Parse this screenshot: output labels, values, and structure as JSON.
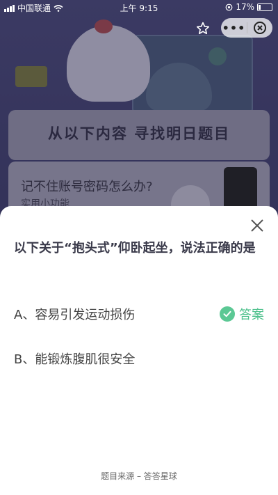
{
  "status_bar": {
    "carrier": "中国联通",
    "time": "上午 9:15",
    "battery": "17%",
    "battery_level": 0.17
  },
  "capsule": {
    "more_label": "•••"
  },
  "background": {
    "headline": "从以下内容 寻找明日题目",
    "card_title": "记不住账号密码怎么办?",
    "card_subtitle": "实用小功能"
  },
  "sheet": {
    "question": "以下关于“抱头式”仰卧起坐，说法正确的是",
    "options": [
      {
        "label": "A、容易引发运动损伤"
      },
      {
        "label": "B、能锻炼腹肌很安全"
      }
    ],
    "answer_label": "答案",
    "footer": "题目来源 – 答答星球"
  },
  "colors": {
    "answer_green": "#4cc08b",
    "sheet_bg": "#ffffff"
  },
  "icons": [
    "wifi-icon",
    "location-lock-icon",
    "star-icon",
    "close-circle-icon",
    "close-icon",
    "check-icon"
  ]
}
